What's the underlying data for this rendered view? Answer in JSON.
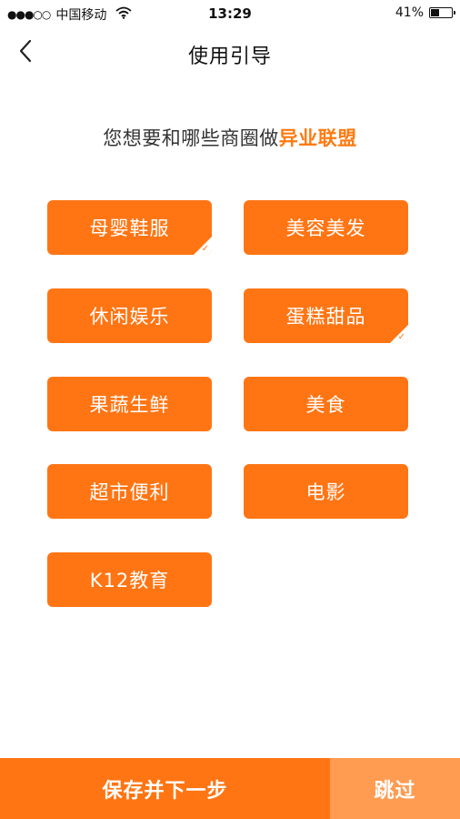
{
  "status_bar": {
    "signal": "●●●○○",
    "carrier": "中国移动",
    "time": "13:29",
    "battery_percent": "41%",
    "battery_level": 0.41
  },
  "nav": {
    "back_icon": "chevron-left-icon",
    "title": "使用引导"
  },
  "question": {
    "prefix": "您想要和哪些商圈做",
    "highlight": "异业联盟"
  },
  "categories": [
    {
      "label": "母婴鞋服",
      "selected": true
    },
    {
      "label": "美容美发",
      "selected": false
    },
    {
      "label": "休闲娱乐",
      "selected": false
    },
    {
      "label": "蛋糕甜品",
      "selected": true
    },
    {
      "label": "果蔬生鲜",
      "selected": false
    },
    {
      "label": "美食",
      "selected": false
    },
    {
      "label": "超市便利",
      "selected": false
    },
    {
      "label": "电影",
      "selected": false
    },
    {
      "label": "K12教育",
      "selected": false
    }
  ],
  "bottom": {
    "save_label": "保存并下一步",
    "skip_label": "跳过"
  },
  "colors": {
    "accent": "#ff7514",
    "skip_bg": "#ff9c52",
    "highlight_text": "#ff7a10"
  }
}
